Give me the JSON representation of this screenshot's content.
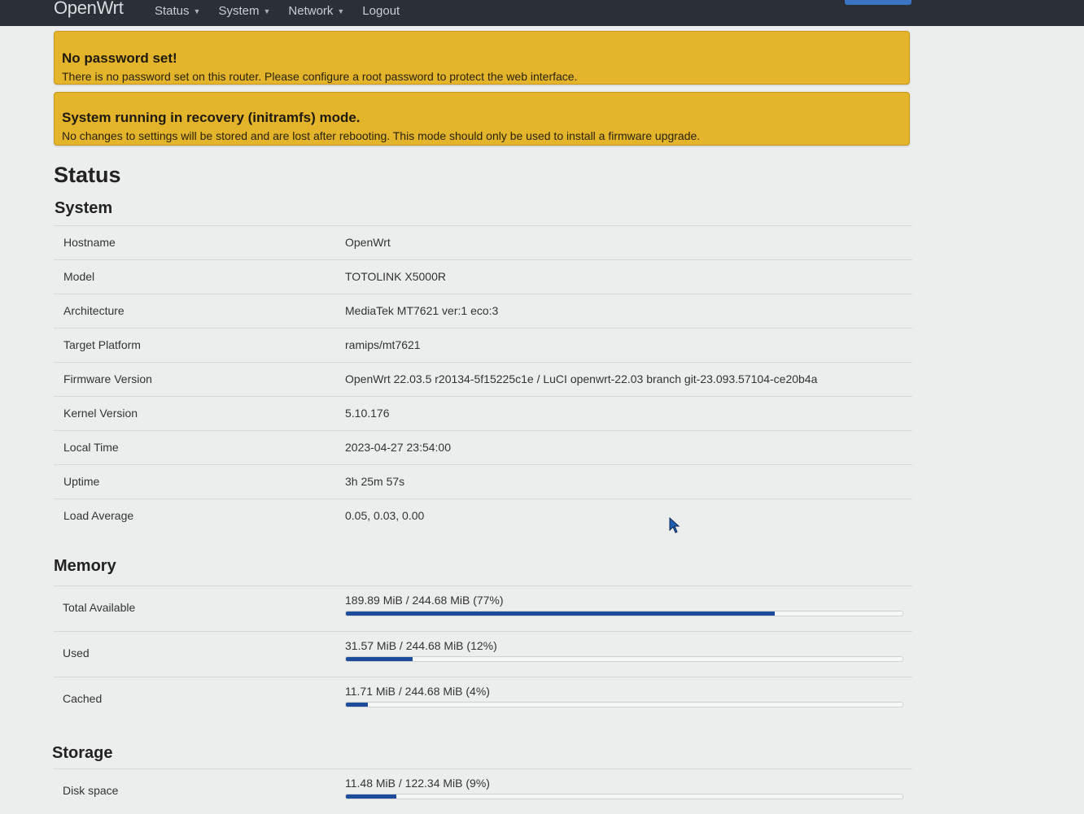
{
  "header": {
    "brand": "OpenWrt",
    "nav": [
      {
        "label": "Status",
        "dropdown": true
      },
      {
        "label": "System",
        "dropdown": true
      },
      {
        "label": "Network",
        "dropdown": true
      },
      {
        "label": "Logout",
        "dropdown": false
      }
    ]
  },
  "alerts": [
    {
      "title": "No password set!",
      "message": "There is no password set on this router. Please configure a root password to protect the web interface."
    },
    {
      "title": "System running in recovery (initramfs) mode.",
      "message": "No changes to settings will be stored and are lost after rebooting. This mode should only be used to install a firmware upgrade."
    }
  ],
  "page_title": "Status",
  "system": {
    "title": "System",
    "rows": [
      {
        "label": "Hostname",
        "value": "OpenWrt"
      },
      {
        "label": "Model",
        "value": "TOTOLINK X5000R"
      },
      {
        "label": "Architecture",
        "value": "MediaTek MT7621 ver:1 eco:3"
      },
      {
        "label": "Target Platform",
        "value": "ramips/mt7621"
      },
      {
        "label": "Firmware Version",
        "value": "OpenWrt 22.03.5 r20134-5f15225c1e / LuCI openwrt-22.03 branch git-23.093.57104-ce20b4a"
      },
      {
        "label": "Kernel Version",
        "value": "5.10.176"
      },
      {
        "label": "Local Time",
        "value": "2023-04-27 23:54:00"
      },
      {
        "label": "Uptime",
        "value": "3h 25m 57s"
      },
      {
        "label": "Load Average",
        "value": "0.05, 0.03, 0.00"
      }
    ]
  },
  "memory": {
    "title": "Memory",
    "rows": [
      {
        "label": "Total Available",
        "text": "189.89 MiB / 244.68 MiB (77%)",
        "percent": 77
      },
      {
        "label": "Used",
        "text": "31.57 MiB / 244.68 MiB (12%)",
        "percent": 12
      },
      {
        "label": "Cached",
        "text": "11.71 MiB / 244.68 MiB (4%)",
        "percent": 4
      }
    ]
  },
  "storage": {
    "title": "Storage",
    "rows": [
      {
        "label": "Disk space",
        "text": "11.48 MiB / 122.34 MiB (9%)",
        "percent": 9
      }
    ]
  },
  "colors": {
    "topbar": "#2b3036",
    "alert": "#e4b52a",
    "progress_fill": "#1d4d9a"
  }
}
